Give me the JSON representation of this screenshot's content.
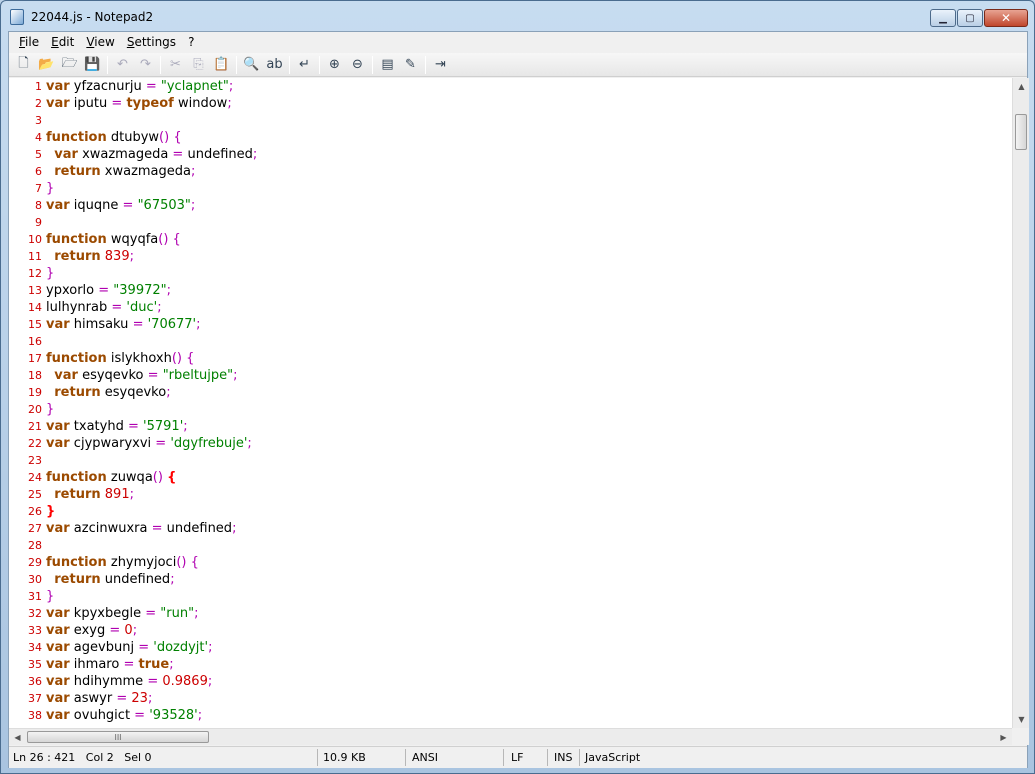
{
  "window": {
    "title": "22044.js - Notepad2"
  },
  "menu": [
    "File",
    "Edit",
    "View",
    "Settings",
    "?"
  ],
  "toolbar": [
    {
      "name": "new-file-icon",
      "glyph": "🗋",
      "enabled": true
    },
    {
      "name": "open-file-icon",
      "glyph": "📂",
      "enabled": true
    },
    {
      "name": "browse-icon",
      "glyph": "🗁",
      "enabled": true
    },
    {
      "name": "save-icon",
      "glyph": "💾",
      "enabled": true
    },
    {
      "sep": true
    },
    {
      "name": "undo-icon",
      "glyph": "↶",
      "enabled": false
    },
    {
      "name": "redo-icon",
      "glyph": "↷",
      "enabled": false
    },
    {
      "sep": true
    },
    {
      "name": "cut-icon",
      "glyph": "✂",
      "enabled": false
    },
    {
      "name": "copy-icon",
      "glyph": "⎘",
      "enabled": false
    },
    {
      "name": "paste-icon",
      "glyph": "📋",
      "enabled": false
    },
    {
      "sep": true
    },
    {
      "name": "find-icon",
      "glyph": "🔍",
      "enabled": true
    },
    {
      "name": "replace-icon",
      "glyph": "ab",
      "enabled": true
    },
    {
      "sep": true
    },
    {
      "name": "word-wrap-icon",
      "glyph": "↵",
      "enabled": true
    },
    {
      "sep": true
    },
    {
      "name": "zoom-in-icon",
      "glyph": "⊕",
      "enabled": true
    },
    {
      "name": "zoom-out-icon",
      "glyph": "⊖",
      "enabled": true
    },
    {
      "sep": true
    },
    {
      "name": "scheme-icon",
      "glyph": "▤",
      "enabled": true
    },
    {
      "name": "customize-scheme-icon",
      "glyph": "✎",
      "enabled": true
    },
    {
      "sep": true
    },
    {
      "name": "exit-icon",
      "glyph": "⇥",
      "enabled": true
    }
  ],
  "editor": {
    "lines": [
      {
        "n": "1",
        "t": [
          [
            "kw",
            "var"
          ],
          [
            "p",
            " yfzacnurju "
          ],
          [
            "op",
            "="
          ],
          [
            "p",
            " "
          ],
          [
            "str",
            "\"yclapnet\""
          ],
          [
            "op",
            ";"
          ]
        ]
      },
      {
        "n": "2",
        "t": [
          [
            "kw",
            "var"
          ],
          [
            "p",
            " iputu "
          ],
          [
            "op",
            "="
          ],
          [
            "p",
            " "
          ],
          [
            "kw",
            "typeof"
          ],
          [
            "p",
            " window"
          ],
          [
            "op",
            ";"
          ]
        ]
      },
      {
        "n": "3",
        "t": []
      },
      {
        "n": "4",
        "t": [
          [
            "kw",
            "function"
          ],
          [
            "p",
            " dtubyw"
          ],
          [
            "op",
            "() {"
          ]
        ]
      },
      {
        "n": "5",
        "t": [
          [
            "p",
            "  "
          ],
          [
            "kw",
            "var"
          ],
          [
            "p",
            " xwazmageda "
          ],
          [
            "op",
            "="
          ],
          [
            "p",
            " undefined"
          ],
          [
            "op",
            ";"
          ]
        ]
      },
      {
        "n": "6",
        "t": [
          [
            "p",
            "  "
          ],
          [
            "kw",
            "return"
          ],
          [
            "p",
            " xwazmageda"
          ],
          [
            "op",
            ";"
          ]
        ]
      },
      {
        "n": "7",
        "t": [
          [
            "op",
            "}"
          ]
        ]
      },
      {
        "n": "8",
        "t": [
          [
            "kw",
            "var"
          ],
          [
            "p",
            " iquqne "
          ],
          [
            "op",
            "="
          ],
          [
            "p",
            " "
          ],
          [
            "str",
            "\"67503\""
          ],
          [
            "op",
            ";"
          ]
        ]
      },
      {
        "n": "9",
        "t": []
      },
      {
        "n": "10",
        "t": [
          [
            "kw",
            "function"
          ],
          [
            "p",
            " wqyqfa"
          ],
          [
            "op",
            "() {"
          ]
        ]
      },
      {
        "n": "11",
        "t": [
          [
            "p",
            "  "
          ],
          [
            "kw",
            "return"
          ],
          [
            "p",
            " "
          ],
          [
            "num",
            "839"
          ],
          [
            "op",
            ";"
          ]
        ]
      },
      {
        "n": "12",
        "t": [
          [
            "op",
            "}"
          ]
        ]
      },
      {
        "n": "13",
        "t": [
          [
            "p",
            "ypxorlo "
          ],
          [
            "op",
            "="
          ],
          [
            "p",
            " "
          ],
          [
            "str",
            "\"39972\""
          ],
          [
            "op",
            ";"
          ]
        ]
      },
      {
        "n": "14",
        "t": [
          [
            "p",
            "lulhynrab "
          ],
          [
            "op",
            "="
          ],
          [
            "p",
            " "
          ],
          [
            "str",
            "'duc'"
          ],
          [
            "op",
            ";"
          ]
        ]
      },
      {
        "n": "15",
        "t": [
          [
            "kw",
            "var"
          ],
          [
            "p",
            " himsaku "
          ],
          [
            "op",
            "="
          ],
          [
            "p",
            " "
          ],
          [
            "str",
            "'70677'"
          ],
          [
            "op",
            ";"
          ]
        ]
      },
      {
        "n": "16",
        "t": []
      },
      {
        "n": "17",
        "t": [
          [
            "kw",
            "function"
          ],
          [
            "p",
            " islykhoxh"
          ],
          [
            "op",
            "() {"
          ]
        ]
      },
      {
        "n": "18",
        "t": [
          [
            "p",
            "  "
          ],
          [
            "kw",
            "var"
          ],
          [
            "p",
            " esyqevko "
          ],
          [
            "op",
            "="
          ],
          [
            "p",
            " "
          ],
          [
            "str",
            "\"rbeltujpe\""
          ],
          [
            "op",
            ";"
          ]
        ]
      },
      {
        "n": "19",
        "t": [
          [
            "p",
            "  "
          ],
          [
            "kw",
            "return"
          ],
          [
            "p",
            " esyqevko"
          ],
          [
            "op",
            ";"
          ]
        ]
      },
      {
        "n": "20",
        "t": [
          [
            "op",
            "}"
          ]
        ]
      },
      {
        "n": "21",
        "t": [
          [
            "kw",
            "var"
          ],
          [
            "p",
            " txatyhd "
          ],
          [
            "op",
            "="
          ],
          [
            "p",
            " "
          ],
          [
            "str",
            "'5791'"
          ],
          [
            "op",
            ";"
          ]
        ]
      },
      {
        "n": "22",
        "t": [
          [
            "kw",
            "var"
          ],
          [
            "p",
            " cjypwaryxvi "
          ],
          [
            "op",
            "="
          ],
          [
            "p",
            " "
          ],
          [
            "str",
            "'dgyfrebuje'"
          ],
          [
            "op",
            ";"
          ]
        ]
      },
      {
        "n": "23",
        "t": []
      },
      {
        "n": "24",
        "t": [
          [
            "kw",
            "function"
          ],
          [
            "p",
            " zuwqa"
          ],
          [
            "op",
            "() "
          ],
          [
            "hi",
            "{"
          ]
        ]
      },
      {
        "n": "25",
        "t": [
          [
            "p",
            "  "
          ],
          [
            "kw",
            "return"
          ],
          [
            "p",
            " "
          ],
          [
            "num",
            "891"
          ],
          [
            "op",
            ";"
          ]
        ]
      },
      {
        "n": "26",
        "t": [
          [
            "hi",
            "}"
          ]
        ]
      },
      {
        "n": "27",
        "t": [
          [
            "kw",
            "var"
          ],
          [
            "p",
            " azcinwuxra "
          ],
          [
            "op",
            "="
          ],
          [
            "p",
            " undefined"
          ],
          [
            "op",
            ";"
          ]
        ]
      },
      {
        "n": "28",
        "t": []
      },
      {
        "n": "29",
        "t": [
          [
            "kw",
            "function"
          ],
          [
            "p",
            " zhymyjoci"
          ],
          [
            "op",
            "() {"
          ]
        ]
      },
      {
        "n": "30",
        "t": [
          [
            "p",
            "  "
          ],
          [
            "kw",
            "return"
          ],
          [
            "p",
            " undefined"
          ],
          [
            "op",
            ";"
          ]
        ]
      },
      {
        "n": "31",
        "t": [
          [
            "op",
            "}"
          ]
        ]
      },
      {
        "n": "32",
        "t": [
          [
            "kw",
            "var"
          ],
          [
            "p",
            " kpyxbegle "
          ],
          [
            "op",
            "="
          ],
          [
            "p",
            " "
          ],
          [
            "str",
            "\"run\""
          ],
          [
            "op",
            ";"
          ]
        ]
      },
      {
        "n": "33",
        "t": [
          [
            "kw",
            "var"
          ],
          [
            "p",
            " exyg "
          ],
          [
            "op",
            "="
          ],
          [
            "p",
            " "
          ],
          [
            "num",
            "0"
          ],
          [
            "op",
            ";"
          ]
        ]
      },
      {
        "n": "34",
        "t": [
          [
            "kw",
            "var"
          ],
          [
            "p",
            " agevbunj "
          ],
          [
            "op",
            "="
          ],
          [
            "p",
            " "
          ],
          [
            "str",
            "'dozdyjt'"
          ],
          [
            "op",
            ";"
          ]
        ]
      },
      {
        "n": "35",
        "t": [
          [
            "kw",
            "var"
          ],
          [
            "p",
            " ihmaro "
          ],
          [
            "op",
            "="
          ],
          [
            "p",
            " "
          ],
          [
            "kw",
            "true"
          ],
          [
            "op",
            ";"
          ]
        ]
      },
      {
        "n": "36",
        "t": [
          [
            "kw",
            "var"
          ],
          [
            "p",
            " hdihymme "
          ],
          [
            "op",
            "="
          ],
          [
            "p",
            " "
          ],
          [
            "num",
            "0.9869"
          ],
          [
            "op",
            ";"
          ]
        ]
      },
      {
        "n": "37",
        "t": [
          [
            "kw",
            "var"
          ],
          [
            "p",
            " aswyr "
          ],
          [
            "op",
            "="
          ],
          [
            "p",
            " "
          ],
          [
            "num",
            "23"
          ],
          [
            "op",
            ";"
          ]
        ]
      },
      {
        "n": "38",
        "t": [
          [
            "kw",
            "var"
          ],
          [
            "p",
            " ovuhgict "
          ],
          [
            "op",
            "="
          ],
          [
            "p",
            " "
          ],
          [
            "str",
            "'93528'"
          ],
          [
            "op",
            ";"
          ]
        ]
      }
    ]
  },
  "statusbar": {
    "position": "Ln 26 : 421   Col 2   Sel 0",
    "size": "10.9 KB",
    "encoding": "ANSI",
    "eol": "LF",
    "mode": "INS",
    "lexer": "JavaScript"
  },
  "scrollbar": {
    "h_thumb_label": "III"
  }
}
